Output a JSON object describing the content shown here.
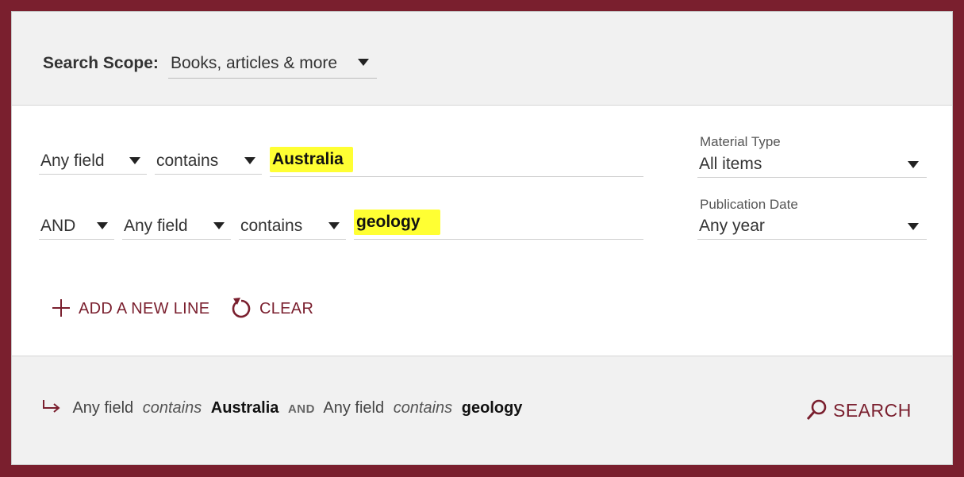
{
  "scope": {
    "label": "Search Scope:",
    "value": "Books, articles & more"
  },
  "lines": [
    {
      "field": "Any field",
      "operator": "contains",
      "term": "Australia"
    },
    {
      "boolean": "AND",
      "field": "Any field",
      "operator": "contains",
      "term": "geology"
    }
  ],
  "filters": {
    "material_type": {
      "label": "Material Type",
      "value": "All items"
    },
    "publication_date": {
      "label": "Publication Date",
      "value": "Any year"
    }
  },
  "actions": {
    "add_line": "ADD A NEW LINE",
    "clear": "CLEAR"
  },
  "summary": {
    "field1": "Any field",
    "op1": "contains",
    "term1": "Australia",
    "bool": "AND",
    "field2": "Any field",
    "op2": "contains",
    "term2": "geology"
  },
  "search_button": "SEARCH",
  "colors": {
    "brand": "#7a1f2e",
    "highlight": "#ffff33",
    "panel_gray": "#f1f1f1"
  }
}
